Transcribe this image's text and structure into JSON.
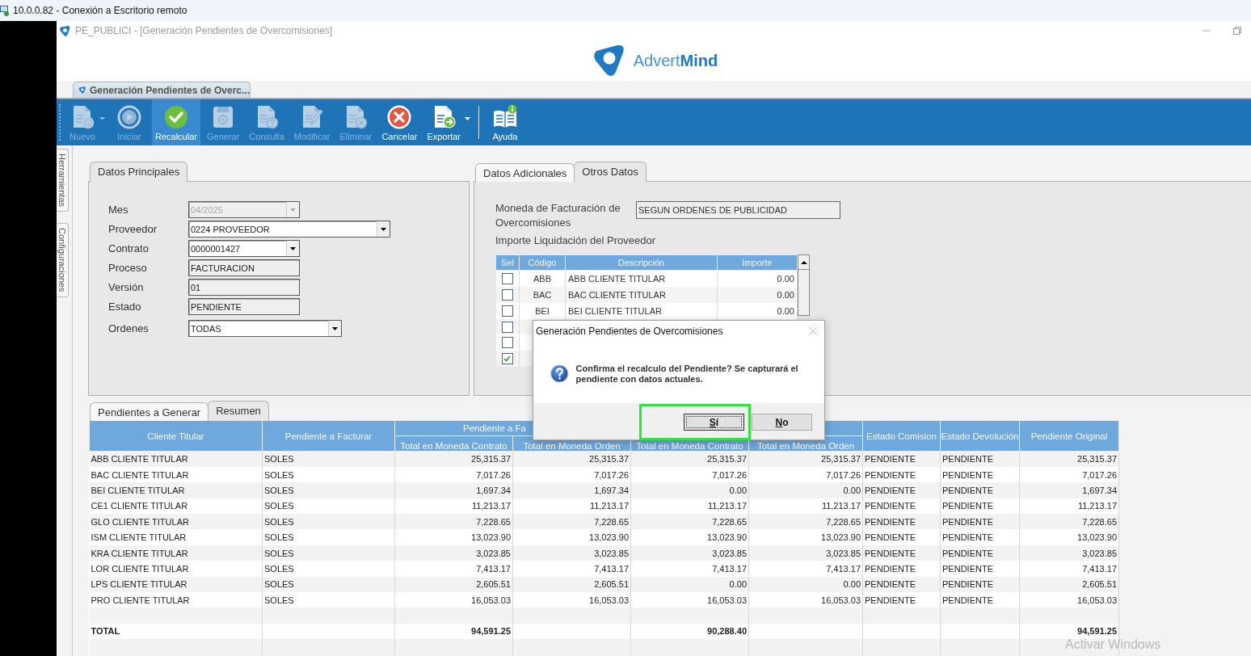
{
  "remote_window": {
    "title": "10.0.0.82 - Conexión a Escritorio remoto"
  },
  "app": {
    "title": "PE_PUBLICI - [Generación Pendientes de Overcomisiones]",
    "logo": "Advert**Mind**"
  },
  "document_tab": {
    "label": "Generación Pendientes de Overc..."
  },
  "toolbar": [
    {
      "label": "Nuevo",
      "kind": "new",
      "disabled": true,
      "dropdown": true,
      "selected": false
    },
    {
      "label": "Iniciar",
      "kind": "start",
      "disabled": true,
      "dropdown": false,
      "selected": false
    },
    {
      "label": "Recalcular",
      "kind": "check",
      "disabled": false,
      "dropdown": false,
      "selected": true
    },
    {
      "label": "Generar",
      "kind": "save",
      "disabled": true,
      "dropdown": false,
      "selected": false
    },
    {
      "label": "Consulta",
      "kind": "query",
      "disabled": true,
      "dropdown": false,
      "selected": false
    },
    {
      "label": "Modificar",
      "kind": "edit",
      "disabled": true,
      "dropdown": false,
      "selected": false
    },
    {
      "label": "Eliminar",
      "kind": "delete",
      "disabled": true,
      "dropdown": false,
      "selected": false
    },
    {
      "label": "Cancelar",
      "kind": "cancel",
      "disabled": false,
      "dropdown": false,
      "selected": false
    },
    {
      "label": "Exportar",
      "kind": "export",
      "disabled": false,
      "dropdown": true,
      "selected": false
    },
    {
      "label": "Ayuda",
      "kind": "help",
      "disabled": false,
      "dropdown": false,
      "selected": false
    }
  ],
  "side_tabs": [
    "Herramientas",
    "Configuraciones"
  ],
  "main_tabs": [
    {
      "label": "Datos Principales",
      "selected": true
    }
  ],
  "main_fields": [
    {
      "label": "Mes",
      "value": "04/2025",
      "kind": "dropdown",
      "disabled": true
    },
    {
      "label": "Proveedor",
      "value": "0224 PROVEEDOR",
      "kind": "dropdown",
      "disabled": false
    },
    {
      "label": "Contrato",
      "value": "0000001427",
      "kind": "dropdown",
      "disabled": false
    },
    {
      "label": "Proceso",
      "value": "FACTURACION",
      "kind": "text",
      "disabled": false
    },
    {
      "label": "Versión",
      "value": "01",
      "kind": "text",
      "disabled": false
    },
    {
      "label": "Estado",
      "value": "PENDIENTE",
      "kind": "text",
      "disabled": false
    },
    {
      "label": "Ordenes",
      "value": "TODAS",
      "kind": "dropdown",
      "disabled": false
    }
  ],
  "extra_tabs": [
    {
      "label": "Datos Adicionales",
      "selected": false
    },
    {
      "label": "Otros Datos",
      "selected": true
    }
  ],
  "currency": {
    "label": "Moneda de Facturación de Overcomisiones",
    "value": "SEGUN ORDENES DE PUBLICIDAD"
  },
  "settlement": {
    "title": "Importe Liquidación del Proveedor",
    "columns": [
      "Sel",
      "Código",
      "Descripción",
      "Importe"
    ],
    "rows": [
      {
        "checked": false,
        "code": "ABB",
        "description": "ABB CLIENTE TITULAR",
        "amount": "0.00"
      },
      {
        "checked": false,
        "code": "BAC",
        "description": "BAC CLIENTE TITULAR",
        "amount": "0.00"
      },
      {
        "checked": false,
        "code": "BEI",
        "description": "BEI CLIENTE TITULAR",
        "amount": "0.00"
      },
      {
        "checked": false
      },
      {
        "checked": false
      },
      {
        "checked": true
      }
    ]
  },
  "result_tabs": [
    {
      "label": "Pendientes a Generar",
      "selected": false
    },
    {
      "label": "Resumen",
      "selected": true
    }
  ],
  "summary": {
    "columns": [
      {
        "label": "Cliente Titular"
      },
      {
        "label": "Pendiente a Facturar"
      },
      {
        "label": "Total en Moneda Contrato"
      },
      {
        "label": "Total en Moneda Orden"
      },
      {
        "label": "Total en Moneda Contrato"
      },
      {
        "label": "Total en Moneda Orden"
      },
      {
        "label": "Estado Comision"
      },
      {
        "label": "Estado Devolución"
      },
      {
        "label": "Pendiente Original"
      }
    ],
    "header_groups": [
      "Pendiente a Fa"
    ],
    "rows": [
      [
        "ABB CLIENTE TITULAR",
        "SOLES",
        "25,315.37",
        "25,315.37",
        "25,315.37",
        "25,315.37",
        "PENDIENTE",
        "PENDIENTE",
        "25,315.37"
      ],
      [
        "BAC CLIENTE TITULAR",
        "SOLES",
        "7,017.26",
        "7,017.26",
        "7,017.26",
        "7,017.26",
        "PENDIENTE",
        "PENDIENTE",
        "7,017.26"
      ],
      [
        "BEI CLIENTE TITULAR",
        "SOLES",
        "1,697.34",
        "1,697.34",
        "0.00",
        "0.00",
        "PENDIENTE",
        "PENDIENTE",
        "1,697.34"
      ],
      [
        "CE1 CLIENTE TITULAR",
        "SOLES",
        "11,213.17",
        "11,213.17",
        "11,213.17",
        "11,213.17",
        "PENDIENTE",
        "PENDIENTE",
        "11,213.17"
      ],
      [
        "GLO CLIENTE TITULAR",
        "SOLES",
        "7,228.65",
        "7,228.65",
        "7,228.65",
        "7,228.65",
        "PENDIENTE",
        "PENDIENTE",
        "7,228.65"
      ],
      [
        "ISM CLIENTE TITULAR",
        "SOLES",
        "13,023.90",
        "13,023.90",
        "13,023.90",
        "13,023.90",
        "PENDIENTE",
        "PENDIENTE",
        "13,023.90"
      ],
      [
        "KRA CLIENTE TITULAR",
        "SOLES",
        "3,023.85",
        "3,023.85",
        "3,023.85",
        "3,023.85",
        "PENDIENTE",
        "PENDIENTE",
        "3,023.85"
      ],
      [
        "LOR CLIENTE TITULAR",
        "SOLES",
        "7,413.17",
        "7,413.17",
        "7,413.17",
        "7,413.17",
        "PENDIENTE",
        "PENDIENTE",
        "7,413.17"
      ],
      [
        "LPS CLIENTE TITULAR",
        "SOLES",
        "2,605.51",
        "2,605.51",
        "0.00",
        "0.00",
        "PENDIENTE",
        "PENDIENTE",
        "2,605.51"
      ],
      [
        "PRO CLIENTE TITULAR",
        "SOLES",
        "16,053.03",
        "16,053.03",
        "16,053.03",
        "16,053.03",
        "PENDIENTE",
        "PENDIENTE",
        "16,053.03"
      ]
    ],
    "total": {
      "label": "TOTAL",
      "contract_total": "94,591.25",
      "recalculated_contract_total": "90,288.40",
      "original_total": "94,591.25"
    }
  },
  "dialog": {
    "title": "Generación Pendientes de Overcomisiones",
    "message": "Confirma el recalculo del Pendiente? Se capturará el pendiente con datos actuales.",
    "buttons": [
      {
        "label": "Sí",
        "focused": true,
        "highlighted": true
      },
      {
        "label": "No",
        "focused": false,
        "highlighted": false
      }
    ]
  },
  "os_notice": "Activar Windows"
}
